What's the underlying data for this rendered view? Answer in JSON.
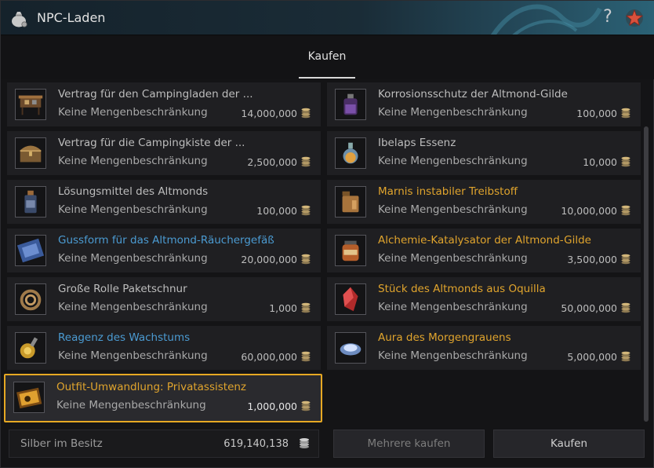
{
  "window": {
    "title": "NPC-Laden",
    "help_glyph": "?"
  },
  "tabs": [
    {
      "label": "Kaufen",
      "active": true
    }
  ],
  "items": [
    {
      "name": "Vertrag für den Campingladen der ...",
      "limit": "Keine Mengenbeschränkung",
      "price": "14,000,000",
      "name_color": "default",
      "icon": "vendor-stall-icon"
    },
    {
      "name": "Korrosionsschutz der Altmond-Gilde",
      "limit": "Keine Mengenbeschränkung",
      "price": "100,000",
      "name_color": "default",
      "icon": "purple-potion-icon"
    },
    {
      "name": "Vertrag für die Campingkiste der ...",
      "limit": "Keine Mengenbeschränkung",
      "price": "2,500,000",
      "name_color": "default",
      "icon": "chest-icon"
    },
    {
      "name": "Ibelaps Essenz",
      "limit": "Keine Mengenbeschränkung",
      "price": "10,000",
      "name_color": "default",
      "icon": "flask-icon"
    },
    {
      "name": "Lösungsmittel des Altmonds",
      "limit": "Keine Mengenbeschränkung",
      "price": "100,000",
      "name_color": "default",
      "icon": "bottle-icon"
    },
    {
      "name": "Marnis instabiler Treibstoff",
      "limit": "Keine Mengenbeschränkung",
      "price": "10,000,000",
      "name_color": "gold",
      "icon": "fuel-canister-icon"
    },
    {
      "name": "Gussform für das Altmond-Räuchergefäß",
      "limit": "Keine Mengenbeschränkung",
      "price": "20,000,000",
      "name_color": "blue",
      "icon": "mold-plate-icon"
    },
    {
      "name": "Alchemie-Katalysator der Altmond-Gilde",
      "limit": "Keine Mengenbeschränkung",
      "price": "3,500,000",
      "name_color": "gold",
      "icon": "jar-icon"
    },
    {
      "name": "Große Rolle Paketschnur",
      "limit": "Keine Mengenbeschränkung",
      "price": "1,000",
      "name_color": "default",
      "icon": "rope-coil-icon"
    },
    {
      "name": "Stück des Altmonds aus Oquilla",
      "limit": "Keine Mengenbeschränkung",
      "price": "50,000,000",
      "name_color": "gold",
      "icon": "red-crystal-icon"
    },
    {
      "name": "Reagenz des Wachstums",
      "limit": "Keine Mengenbeschränkung",
      "price": "60,000,000",
      "name_color": "blue",
      "icon": "reagent-flask-icon"
    },
    {
      "name": "Aura des Morgengrauens",
      "limit": "Keine Mengenbeschränkung",
      "price": "5,000,000",
      "name_color": "gold",
      "icon": "aura-icon"
    },
    {
      "name": "Outfit-Umwandlung: Privatassistenz",
      "limit": "Keine Mengenbeschränkung",
      "price": "1,000,000",
      "name_color": "gold",
      "icon": "outfit-voucher-icon",
      "selected": true
    }
  ],
  "footer": {
    "silver_label": "Silber im Besitz",
    "silver_value": "619,140,138",
    "buy_multiple_label": "Mehrere kaufen",
    "buy_label": "Kaufen"
  },
  "colors": {
    "accent_selected": "#e6a823",
    "name_blue": "#4b9bd2",
    "name_gold": "#e0a42d",
    "name_default": "#bdbdbd"
  }
}
